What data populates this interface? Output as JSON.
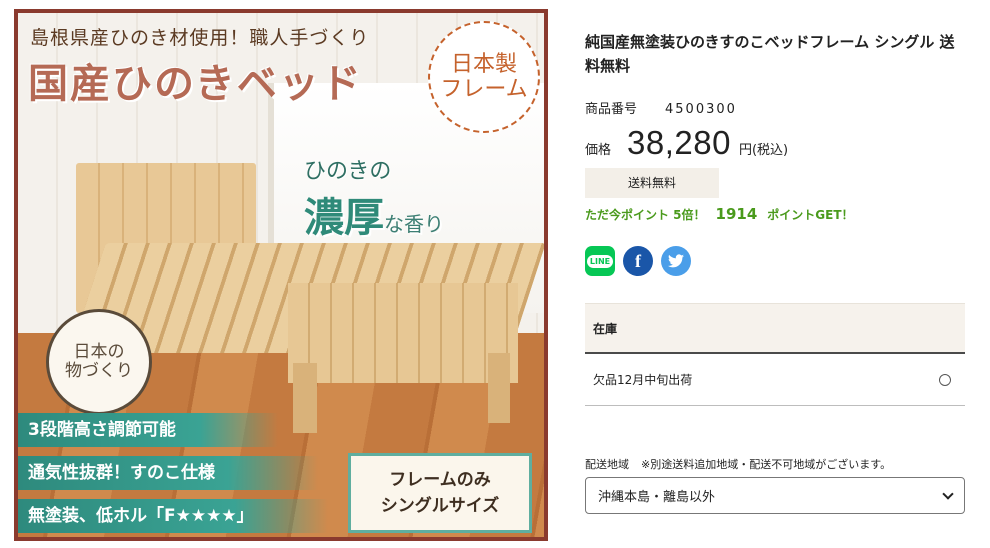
{
  "image": {
    "tagline": "島根県産ひのき材使用！職人手づくり",
    "title": "国産ひのきベッド",
    "badge_line1": "日本製",
    "badge_line2": "フレーム",
    "aroma_line1": "ひのきの",
    "aroma_big": "濃厚",
    "aroma_small": "な香り",
    "stamp_line1": "日本の",
    "stamp_line2": "物づくり",
    "features": [
      "3段階高さ調節可能",
      "通気性抜群！すのこ仕様",
      "無塗装、低ホル「F★★★★」"
    ],
    "size_line1": "フレームのみ",
    "size_line2": "シングルサイズ"
  },
  "product": {
    "title": "純国産無塗装ひのきすのこベッドフレーム シングル 送料無料",
    "sku_label": "商品番号",
    "sku_value": "4500300",
    "price_label": "価格",
    "price_value": "38,280",
    "price_unit": "円(税込)",
    "shipping_badge": "送料無料",
    "points_prefix": "ただ今ポイント 5倍！",
    "points_value": "1914",
    "points_suffix": "ポイントGET！"
  },
  "share": {
    "line_label": "LINE",
    "facebook_label": "f"
  },
  "stock": {
    "header": "在庫",
    "option_label": "欠品12月中旬出荷"
  },
  "delivery": {
    "label": "配送地域",
    "note": "※別途送料追加地域・配送不可地域がございます。",
    "selected": "沖縄本島・離島以外"
  },
  "colors": {
    "accent_green": "#4a9a1c",
    "image_frame": "#8a3a2e",
    "feature_teal": "#2e8a7d"
  }
}
